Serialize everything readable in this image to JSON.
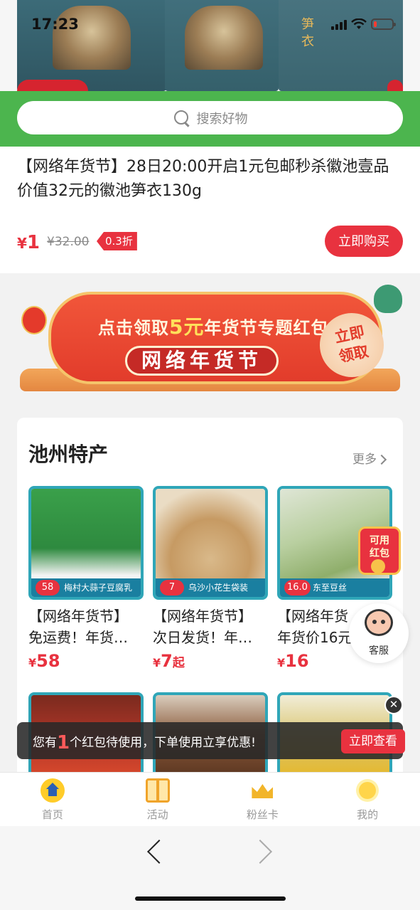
{
  "status_bar": {
    "time": "17:23",
    "battery_level": 0.15
  },
  "hero": {
    "chars": [
      "笋",
      "衣"
    ]
  },
  "search": {
    "placeholder": "搜索好物"
  },
  "product": {
    "title": "【网络年货节】28日20:00开启1元包邮秒杀徽池壹品价值32元的徽池笋衣130g",
    "currency": "¥",
    "price": "1",
    "original_price": "¥32.00",
    "discount": "0.3折",
    "buy_label": "立即购买"
  },
  "banner": {
    "top_prefix": "点击领取",
    "top_amount": "5元",
    "top_suffix": "年货节专题红包",
    "main": "网络年货节",
    "stamp_line1": "立即",
    "stamp_line2": "领取"
  },
  "specialties": {
    "title": "池州特产",
    "more_label": "更多",
    "items": [
      {
        "image_price": "58",
        "image_label": "梅村大蒜子豆腐乳",
        "line1": "【网络年货节】",
        "line2": "免运费！年货…",
        "currency": "¥",
        "price": "58",
        "suffix": ""
      },
      {
        "image_price": "7",
        "image_label": "乌沙小花生袋装",
        "line1": "【网络年货节】",
        "line2": "次日发货！年…",
        "currency": "¥",
        "price": "7",
        "suffix": "起"
      },
      {
        "image_price": "16.0",
        "image_label": "东至豆丝",
        "line1": "【网络年货",
        "line2": "年货价16元",
        "currency": "¥",
        "price": "16",
        "suffix": ""
      }
    ]
  },
  "floating": {
    "redpacket_line1": "可用",
    "redpacket_line2": "红包",
    "service_label": "客服"
  },
  "toast": {
    "prefix": "您有",
    "count": "1",
    "suffix": "个红包待使用，下单使用立享优惠!",
    "button_label": "立即查看",
    "close_glyph": "✕"
  },
  "tabbar": {
    "items": [
      {
        "label": "首页",
        "icon": "home-icon"
      },
      {
        "label": "活动",
        "icon": "gift-icon"
      },
      {
        "label": "粉丝卡",
        "icon": "crown-icon"
      },
      {
        "label": "我的",
        "icon": "sun-icon"
      }
    ]
  },
  "colors": {
    "accent_red": "#e8323f",
    "brand_green": "#4cb54e",
    "teal_border": "#2fa6b8"
  }
}
